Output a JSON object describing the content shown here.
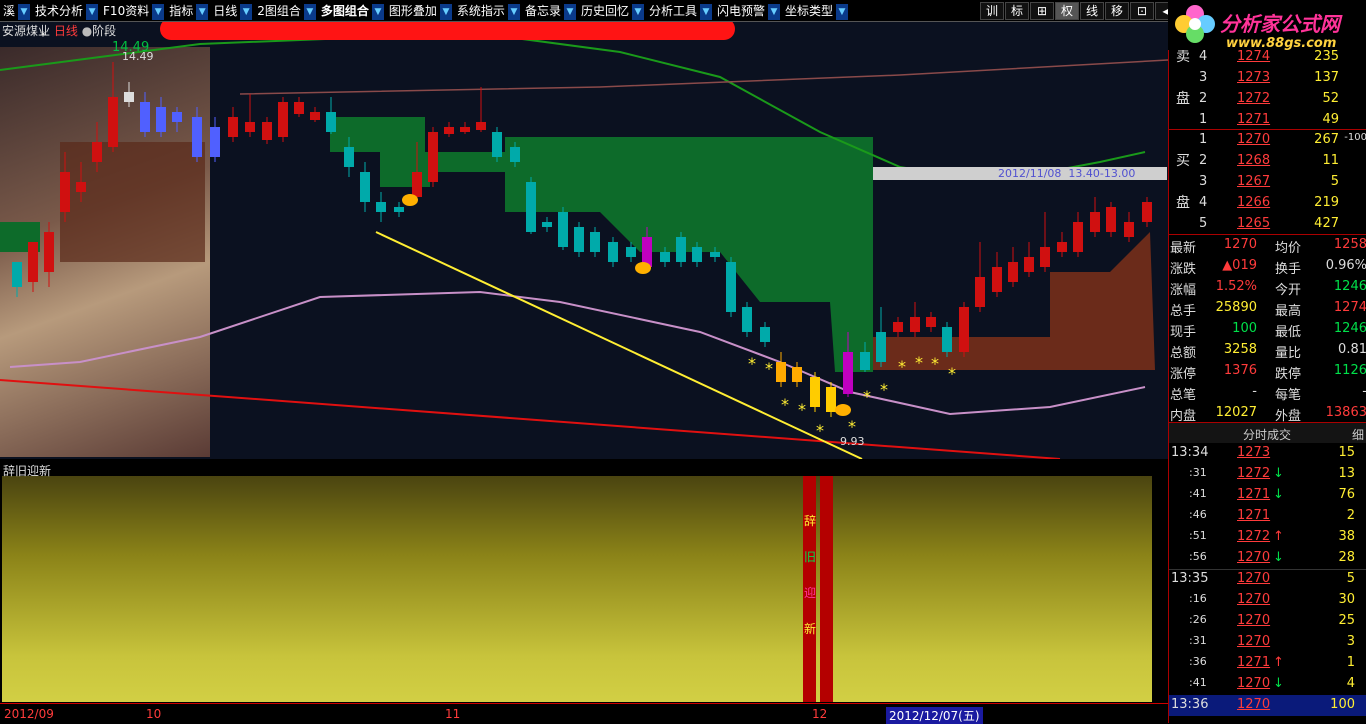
{
  "menu": {
    "items": [
      "溪",
      "技术分析",
      "F10资料",
      "指标",
      "日线",
      "2图组合",
      "多图组合",
      "图形叠加",
      "系统指示",
      "备忘录",
      "历史回忆",
      "分析工具",
      "闪电预警",
      "坐标类型"
    ],
    "active": "多图组合"
  },
  "toolbar": [
    "训",
    "标",
    "⊞",
    "权",
    "线",
    "移",
    "⊡",
    "◀"
  ],
  "toolbar_active": "权",
  "logo": {
    "title": "分析家公式网",
    "url": "www.88gs.com"
  },
  "stock": {
    "name": "安源煤业",
    "type": "日线",
    "extra": "阶段"
  },
  "price_labels": {
    "high_top": "14.49",
    "high_top2": "14.49",
    "low_marker": "9.93",
    "annotation": "2012/11/08  13.40-13.00"
  },
  "lower_panel": {
    "title": "辞旧迎新",
    "vertical_text": [
      "辞",
      "旧",
      "迎",
      "新"
    ]
  },
  "x_axis": {
    "ticks": [
      "2012/09",
      "10",
      "11",
      "12"
    ],
    "current_date": "2012/12/07(五)"
  },
  "orderbook": {
    "sell": [
      {
        "lvl": "4",
        "price": "1274",
        "vol": "235"
      },
      {
        "lvl": "3",
        "price": "1273",
        "vol": "137"
      },
      {
        "lvl": "2",
        "price": "1272",
        "vol": "52"
      },
      {
        "lvl": "1",
        "price": "1271",
        "vol": "49"
      }
    ],
    "buy": [
      {
        "lvl": "1",
        "price": "1270",
        "vol": "267",
        "chg": "-100"
      },
      {
        "lvl": "2",
        "price": "1268",
        "vol": "11"
      },
      {
        "lvl": "3",
        "price": "1267",
        "vol": "5"
      },
      {
        "lvl": "4",
        "price": "1266",
        "vol": "219"
      },
      {
        "lvl": "5",
        "price": "1265",
        "vol": "427"
      }
    ],
    "sell_label": [
      "卖",
      "盘"
    ],
    "buy_label": [
      "买",
      "盘"
    ]
  },
  "quote": [
    [
      "最新",
      "1270",
      "均价",
      "1258"
    ],
    [
      "涨跌",
      "▲019",
      "换手",
      "0.96%"
    ],
    [
      "涨幅",
      "1.52%",
      "今开",
      "1246"
    ],
    [
      "总手",
      "25890",
      "最高",
      "1274"
    ],
    [
      "现手",
      "100",
      "最低",
      "1246"
    ],
    [
      "总额",
      "3258",
      "量比",
      "0.81"
    ],
    [
      "涨停",
      "1376",
      "跌停",
      "1126"
    ],
    [
      "总笔",
      "-",
      "每笔",
      "-"
    ],
    [
      "内盘",
      "12027",
      "外盘",
      "13863"
    ]
  ],
  "trades_header": {
    "title": "分时成交",
    "btn": "细"
  },
  "trades": [
    {
      "t": "13:34",
      "p": "1273",
      "a": "",
      "v": "15",
      "major": true
    },
    {
      "t": ":31",
      "p": "1272",
      "a": "↓",
      "v": "13"
    },
    {
      "t": ":41",
      "p": "1271",
      "a": "↓",
      "v": "76"
    },
    {
      "t": ":46",
      "p": "1271",
      "a": "",
      "v": "2"
    },
    {
      "t": ":51",
      "p": "1272",
      "a": "↑",
      "v": "38"
    },
    {
      "t": ":56",
      "p": "1270",
      "a": "↓",
      "v": "28"
    },
    {
      "t": "13:35",
      "p": "1270",
      "a": "",
      "v": "5",
      "major": true
    },
    {
      "t": ":16",
      "p": "1270",
      "a": "",
      "v": "30"
    },
    {
      "t": ":26",
      "p": "1270",
      "a": "",
      "v": "25"
    },
    {
      "t": ":31",
      "p": "1270",
      "a": "",
      "v": "3"
    },
    {
      "t": ":36",
      "p": "1271",
      "a": "↑",
      "v": "1"
    },
    {
      "t": ":41",
      "p": "1270",
      "a": "↓",
      "v": "4"
    },
    {
      "t": "13:36",
      "p": "1270",
      "a": "",
      "v": "100",
      "major": true,
      "hl": true
    }
  ]
}
